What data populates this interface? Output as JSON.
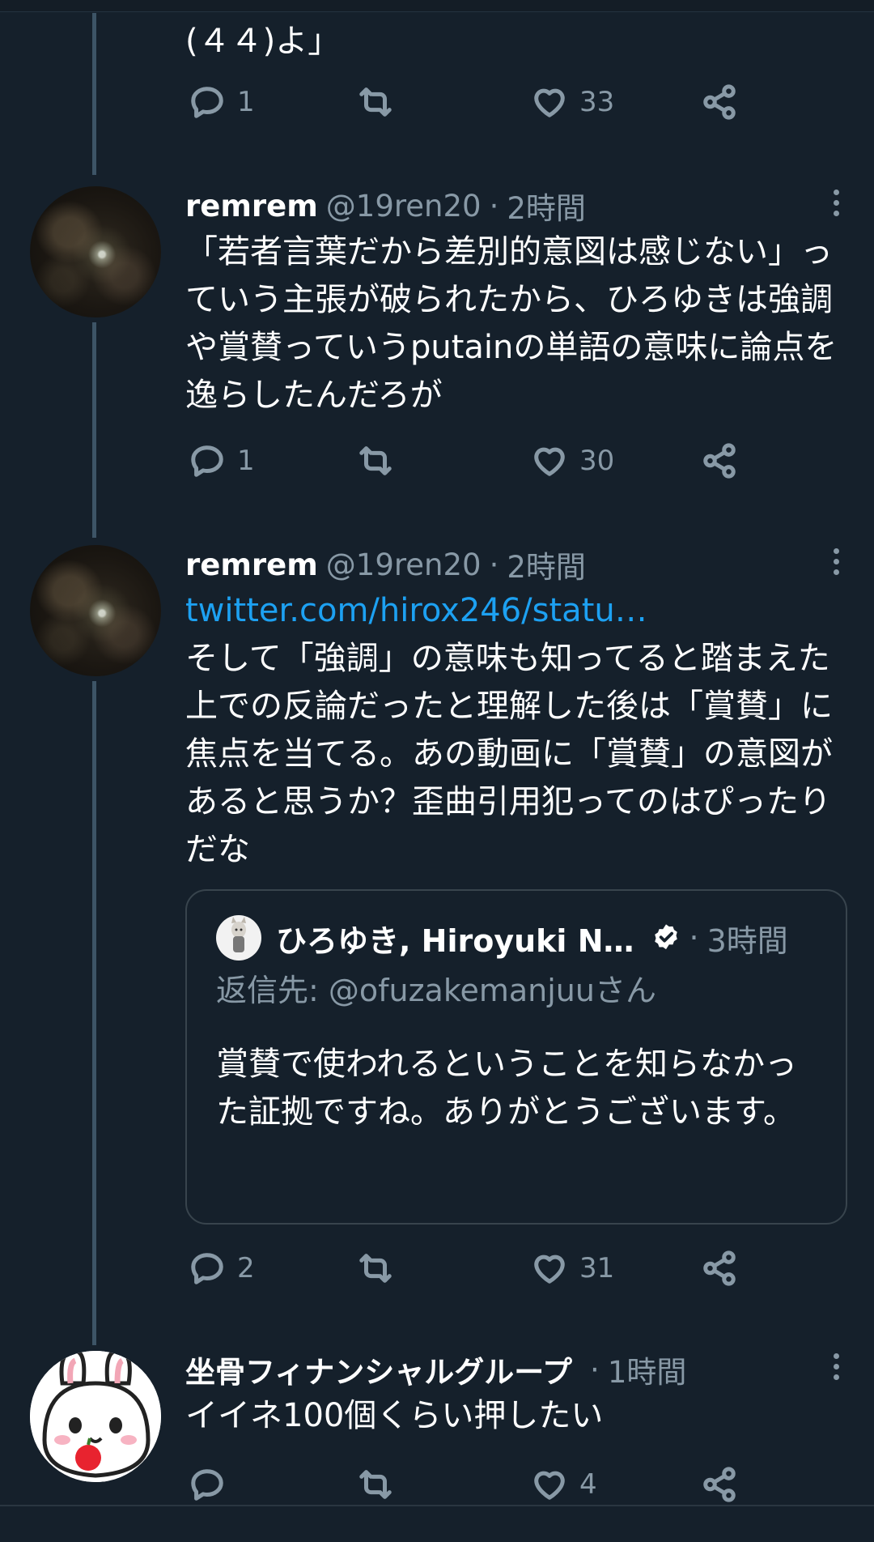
{
  "tweets": [
    {
      "text_tail": "(４４)よ」",
      "actions": {
        "replies": "1",
        "retweets": "",
        "likes": "33"
      }
    },
    {
      "name": "remrem",
      "handle": "@19ren20",
      "dot": "·",
      "time": "2時間",
      "text": "「若者言葉だから差別的意図は感じない」っていう主張が破られたから、ひろゆきは強調や賞賛っていうputainの単語の意味に論点を逸らしたんだろが",
      "actions": {
        "replies": "1",
        "retweets": "",
        "likes": "30"
      }
    },
    {
      "name": "remrem",
      "handle": "@19ren20",
      "dot": "·",
      "time": "2時間",
      "link": "twitter.com/hirox246/statu…",
      "text": "そして「強調」の意味も知ってると踏まえた上での反論だったと理解した後は「賞賛」に焦点を当てる。あの動画に「賞賛」の意図があると思うか？歪曲引用犯ってのはぴったりだな",
      "quote": {
        "name": "ひろゆき, Hiroyuki N…",
        "dot": "·",
        "time": "3時間",
        "reply_to": "返信先: @ofuzakemanjuuさん",
        "text": "賞賛で使われるということを知らなかった証拠ですね。ありがとうございます。"
      },
      "actions": {
        "replies": "2",
        "retweets": "",
        "likes": "31"
      }
    },
    {
      "name": "坐骨フィナンシャルグループ",
      "dot": "·",
      "time": "1時間",
      "text": "イイネ100個くらい押したい",
      "actions": {
        "replies": "",
        "retweets": "",
        "likes": "4"
      }
    }
  ],
  "icons": [
    "reply-icon",
    "retweet-icon",
    "like-icon",
    "share-icon",
    "more-icon",
    "verified-icon"
  ],
  "colors": {
    "background": "#15202b",
    "muted": "#8899a6",
    "link": "#1da1f2",
    "thread_line": "#3d5466"
  }
}
